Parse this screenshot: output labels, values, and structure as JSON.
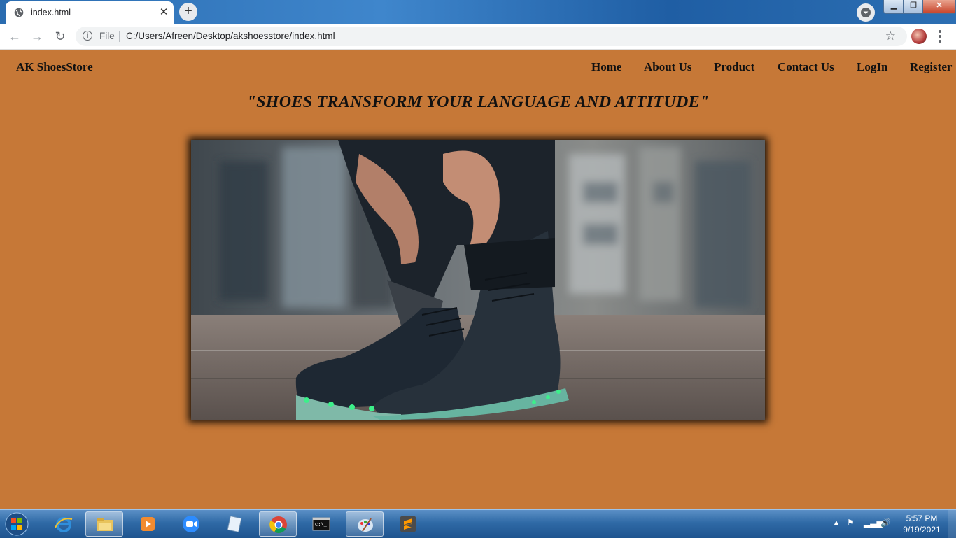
{
  "browser": {
    "tab_title": "index.html",
    "tab_close": "✕",
    "new_tab": "+",
    "omnibox": {
      "scheme_label": "File",
      "url": "C:/Users/Afreen/Desktop/akshoesstore/index.html"
    },
    "nav_icons": [
      "back-icon",
      "forward-icon",
      "reload-icon",
      "info-icon",
      "star-icon",
      "profile-avatar",
      "menu-icon"
    ]
  },
  "site": {
    "brand": "AK ShoesStore",
    "nav": [
      "Home",
      "About Us",
      "Product",
      "Contact Us",
      "LogIn",
      "Register"
    ],
    "tagline": "\"SHOES TRANSFORM YOUR LANGUAGE AND ATTITUDE\"",
    "background_color": "#c67837"
  },
  "taskbar": {
    "apps": [
      "internet-explorer",
      "file-explorer",
      "media-player",
      "zoom",
      "notepad",
      "chrome",
      "command-prompt",
      "paint",
      "sublime-text"
    ],
    "clock": {
      "time": "5:57 PM",
      "date": "9/19/2021"
    }
  }
}
